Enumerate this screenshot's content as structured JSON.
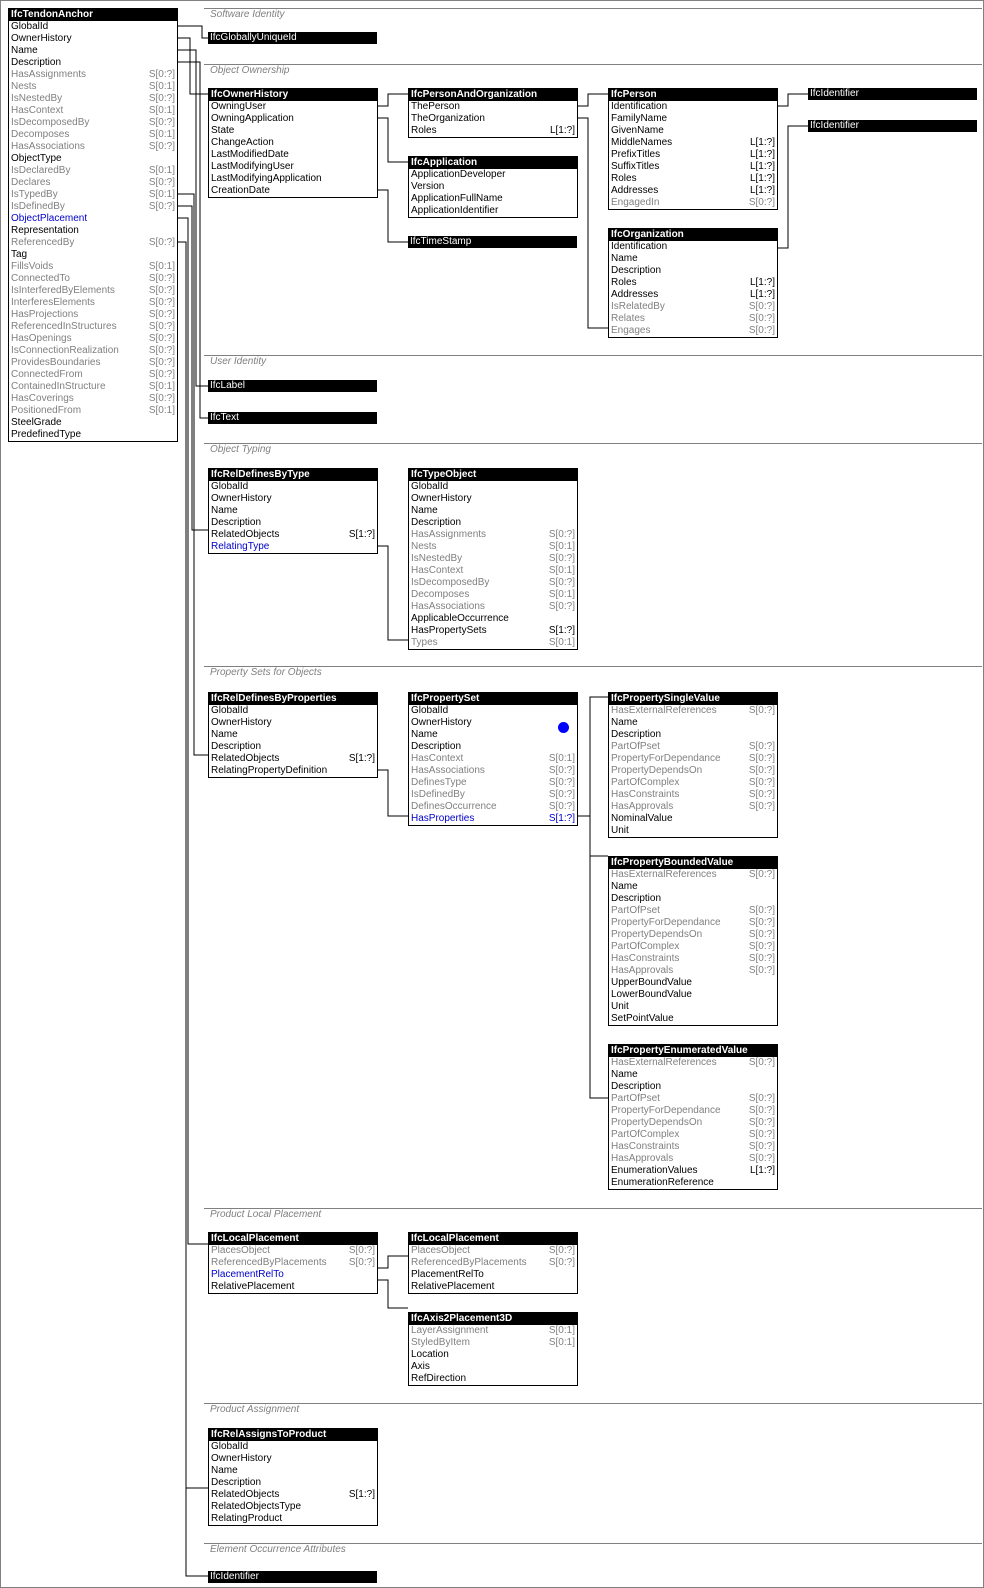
{
  "sections": [
    {
      "title": "Software Identity"
    },
    {
      "title": "Object Ownership"
    },
    {
      "title": "User Identity"
    },
    {
      "title": "Object Typing"
    },
    {
      "title": "Property Sets for Objects"
    },
    {
      "title": "Product Local Placement"
    },
    {
      "title": "Product Assignment"
    },
    {
      "title": "Element Occurrence Attributes"
    }
  ],
  "bars": [
    {
      "label": "IfcGloballyUniqueId"
    },
    {
      "label": "IfcIdentifier"
    },
    {
      "label": "IfcIdentifier"
    },
    {
      "label": "IfcTimeStamp"
    },
    {
      "label": "IfcLabel"
    },
    {
      "label": "IfcText"
    },
    {
      "label": "IfcIdentifier"
    }
  ],
  "entities": [
    {
      "title": "IfcTendonAnchor",
      "rows": [
        {
          "n": "GlobalId",
          "c": "",
          "s": ""
        },
        {
          "n": "OwnerHistory",
          "c": "",
          "s": ""
        },
        {
          "n": "Name",
          "c": "",
          "s": ""
        },
        {
          "n": "Description",
          "c": "",
          "s": ""
        },
        {
          "n": "HasAssignments",
          "c": "S[0:?]",
          "s": "inv"
        },
        {
          "n": "Nests",
          "c": "S[0:1]",
          "s": "inv"
        },
        {
          "n": "IsNestedBy",
          "c": "S[0:?]",
          "s": "inv"
        },
        {
          "n": "HasContext",
          "c": "S[0:1]",
          "s": "inv"
        },
        {
          "n": "IsDecomposedBy",
          "c": "S[0:?]",
          "s": "inv"
        },
        {
          "n": "Decomposes",
          "c": "S[0:1]",
          "s": "inv"
        },
        {
          "n": "HasAssociations",
          "c": "S[0:?]",
          "s": "inv"
        },
        {
          "n": "ObjectType",
          "c": "",
          "s": ""
        },
        {
          "n": "IsDeclaredBy",
          "c": "S[0:1]",
          "s": "inv"
        },
        {
          "n": "Declares",
          "c": "S[0:?]",
          "s": "inv"
        },
        {
          "n": "IsTypedBy",
          "c": "S[0:1]",
          "s": "inv"
        },
        {
          "n": "IsDefinedBy",
          "c": "S[0:?]",
          "s": "inv"
        },
        {
          "n": "ObjectPlacement",
          "c": "",
          "s": "lnk"
        },
        {
          "n": "Representation",
          "c": "",
          "s": ""
        },
        {
          "n": "ReferencedBy",
          "c": "S[0:?]",
          "s": "inv"
        },
        {
          "n": "Tag",
          "c": "",
          "s": ""
        },
        {
          "n": "FillsVoids",
          "c": "S[0:1]",
          "s": "inv"
        },
        {
          "n": "ConnectedTo",
          "c": "S[0:?]",
          "s": "inv"
        },
        {
          "n": "IsInterferedByElements",
          "c": "S[0:?]",
          "s": "inv"
        },
        {
          "n": "InterferesElements",
          "c": "S[0:?]",
          "s": "inv"
        },
        {
          "n": "HasProjections",
          "c": "S[0:?]",
          "s": "inv"
        },
        {
          "n": "ReferencedInStructures",
          "c": "S[0:?]",
          "s": "inv"
        },
        {
          "n": "HasOpenings",
          "c": "S[0:?]",
          "s": "inv"
        },
        {
          "n": "IsConnectionRealization",
          "c": "S[0:?]",
          "s": "inv"
        },
        {
          "n": "ProvidesBoundaries",
          "c": "S[0:?]",
          "s": "inv"
        },
        {
          "n": "ConnectedFrom",
          "c": "S[0:?]",
          "s": "inv"
        },
        {
          "n": "ContainedInStructure",
          "c": "S[0:1]",
          "s": "inv"
        },
        {
          "n": "HasCoverings",
          "c": "S[0:?]",
          "s": "inv"
        },
        {
          "n": "PositionedFrom",
          "c": "S[0:1]",
          "s": "inv"
        },
        {
          "n": "SteelGrade",
          "c": "",
          "s": ""
        },
        {
          "n": "PredefinedType",
          "c": "",
          "s": ""
        }
      ]
    },
    {
      "title": "IfcOwnerHistory",
      "rows": [
        {
          "n": "OwningUser",
          "c": "",
          "s": ""
        },
        {
          "n": "OwningApplication",
          "c": "",
          "s": ""
        },
        {
          "n": "State",
          "c": "",
          "s": ""
        },
        {
          "n": "ChangeAction",
          "c": "",
          "s": ""
        },
        {
          "n": "LastModifiedDate",
          "c": "",
          "s": ""
        },
        {
          "n": "LastModifyingUser",
          "c": "",
          "s": ""
        },
        {
          "n": "LastModifyingApplication",
          "c": "",
          "s": ""
        },
        {
          "n": "CreationDate",
          "c": "",
          "s": ""
        }
      ]
    },
    {
      "title": "IfcPersonAndOrganization",
      "rows": [
        {
          "n": "ThePerson",
          "c": "",
          "s": ""
        },
        {
          "n": "TheOrganization",
          "c": "",
          "s": ""
        },
        {
          "n": "Roles",
          "c": "L[1:?]",
          "s": ""
        }
      ]
    },
    {
      "title": "IfcApplication",
      "rows": [
        {
          "n": "ApplicationDeveloper",
          "c": "",
          "s": ""
        },
        {
          "n": "Version",
          "c": "",
          "s": ""
        },
        {
          "n": "ApplicationFullName",
          "c": "",
          "s": ""
        },
        {
          "n": "ApplicationIdentifier",
          "c": "",
          "s": ""
        }
      ]
    },
    {
      "title": "IfcPerson",
      "rows": [
        {
          "n": "Identification",
          "c": "",
          "s": ""
        },
        {
          "n": "FamilyName",
          "c": "",
          "s": ""
        },
        {
          "n": "GivenName",
          "c": "",
          "s": ""
        },
        {
          "n": "MiddleNames",
          "c": "L[1:?]",
          "s": ""
        },
        {
          "n": "PrefixTitles",
          "c": "L[1:?]",
          "s": ""
        },
        {
          "n": "SuffixTitles",
          "c": "L[1:?]",
          "s": ""
        },
        {
          "n": "Roles",
          "c": "L[1:?]",
          "s": ""
        },
        {
          "n": "Addresses",
          "c": "L[1:?]",
          "s": ""
        },
        {
          "n": "EngagedIn",
          "c": "S[0:?]",
          "s": "inv"
        }
      ]
    },
    {
      "title": "IfcOrganization",
      "rows": [
        {
          "n": "Identification",
          "c": "",
          "s": ""
        },
        {
          "n": "Name",
          "c": "",
          "s": ""
        },
        {
          "n": "Description",
          "c": "",
          "s": ""
        },
        {
          "n": "Roles",
          "c": "L[1:?]",
          "s": ""
        },
        {
          "n": "Addresses",
          "c": "L[1:?]",
          "s": ""
        },
        {
          "n": "IsRelatedBy",
          "c": "S[0:?]",
          "s": "inv"
        },
        {
          "n": "Relates",
          "c": "S[0:?]",
          "s": "inv"
        },
        {
          "n": "Engages",
          "c": "S[0:?]",
          "s": "inv"
        }
      ]
    },
    {
      "title": "IfcRelDefinesByType",
      "rows": [
        {
          "n": "GlobalId",
          "c": "",
          "s": ""
        },
        {
          "n": "OwnerHistory",
          "c": "",
          "s": ""
        },
        {
          "n": "Name",
          "c": "",
          "s": ""
        },
        {
          "n": "Description",
          "c": "",
          "s": ""
        },
        {
          "n": "RelatedObjects",
          "c": "S[1:?]",
          "s": ""
        },
        {
          "n": "RelatingType",
          "c": "",
          "s": "lnk"
        }
      ]
    },
    {
      "title": "IfcTypeObject",
      "rows": [
        {
          "n": "GlobalId",
          "c": "",
          "s": ""
        },
        {
          "n": "OwnerHistory",
          "c": "",
          "s": ""
        },
        {
          "n": "Name",
          "c": "",
          "s": ""
        },
        {
          "n": "Description",
          "c": "",
          "s": ""
        },
        {
          "n": "HasAssignments",
          "c": "S[0:?]",
          "s": "inv"
        },
        {
          "n": "Nests",
          "c": "S[0:1]",
          "s": "inv"
        },
        {
          "n": "IsNestedBy",
          "c": "S[0:?]",
          "s": "inv"
        },
        {
          "n": "HasContext",
          "c": "S[0:1]",
          "s": "inv"
        },
        {
          "n": "IsDecomposedBy",
          "c": "S[0:?]",
          "s": "inv"
        },
        {
          "n": "Decomposes",
          "c": "S[0:1]",
          "s": "inv"
        },
        {
          "n": "HasAssociations",
          "c": "S[0:?]",
          "s": "inv"
        },
        {
          "n": "ApplicableOccurrence",
          "c": "",
          "s": ""
        },
        {
          "n": "HasPropertySets",
          "c": "S[1:?]",
          "s": ""
        },
        {
          "n": "Types",
          "c": "S[0:1]",
          "s": "inv"
        }
      ]
    },
    {
      "title": "IfcRelDefinesByProperties",
      "rows": [
        {
          "n": "GlobalId",
          "c": "",
          "s": ""
        },
        {
          "n": "OwnerHistory",
          "c": "",
          "s": ""
        },
        {
          "n": "Name",
          "c": "",
          "s": ""
        },
        {
          "n": "Description",
          "c": "",
          "s": ""
        },
        {
          "n": "RelatedObjects",
          "c": "S[1:?]",
          "s": ""
        },
        {
          "n": "RelatingPropertyDefinition",
          "c": "",
          "s": ""
        }
      ]
    },
    {
      "title": "IfcPropertySet",
      "rows": [
        {
          "n": "GlobalId",
          "c": "",
          "s": ""
        },
        {
          "n": "OwnerHistory",
          "c": "",
          "s": ""
        },
        {
          "n": "Name",
          "c": "",
          "s": ""
        },
        {
          "n": "Description",
          "c": "",
          "s": ""
        },
        {
          "n": "HasContext",
          "c": "S[0:1]",
          "s": "inv"
        },
        {
          "n": "HasAssociations",
          "c": "S[0:?]",
          "s": "inv"
        },
        {
          "n": "DefinesType",
          "c": "S[0:?]",
          "s": "inv"
        },
        {
          "n": "IsDefinedBy",
          "c": "S[0:?]",
          "s": "inv"
        },
        {
          "n": "DefinesOccurrence",
          "c": "S[0:?]",
          "s": "inv"
        },
        {
          "n": "HasProperties",
          "c": "S[1:?]",
          "s": "lnk"
        }
      ]
    },
    {
      "title": "IfcPropertySingleValue",
      "rows": [
        {
          "n": "HasExternalReferences",
          "c": "S[0:?]",
          "s": "inv"
        },
        {
          "n": "Name",
          "c": "",
          "s": ""
        },
        {
          "n": "Description",
          "c": "",
          "s": ""
        },
        {
          "n": "PartOfPset",
          "c": "S[0:?]",
          "s": "inv"
        },
        {
          "n": "PropertyForDependance",
          "c": "S[0:?]",
          "s": "inv"
        },
        {
          "n": "PropertyDependsOn",
          "c": "S[0:?]",
          "s": "inv"
        },
        {
          "n": "PartOfComplex",
          "c": "S[0:?]",
          "s": "inv"
        },
        {
          "n": "HasConstraints",
          "c": "S[0:?]",
          "s": "inv"
        },
        {
          "n": "HasApprovals",
          "c": "S[0:?]",
          "s": "inv"
        },
        {
          "n": "NominalValue",
          "c": "",
          "s": ""
        },
        {
          "n": "Unit",
          "c": "",
          "s": ""
        }
      ]
    },
    {
      "title": "IfcPropertyBoundedValue",
      "rows": [
        {
          "n": "HasExternalReferences",
          "c": "S[0:?]",
          "s": "inv"
        },
        {
          "n": "Name",
          "c": "",
          "s": ""
        },
        {
          "n": "Description",
          "c": "",
          "s": ""
        },
        {
          "n": "PartOfPset",
          "c": "S[0:?]",
          "s": "inv"
        },
        {
          "n": "PropertyForDependance",
          "c": "S[0:?]",
          "s": "inv"
        },
        {
          "n": "PropertyDependsOn",
          "c": "S[0:?]",
          "s": "inv"
        },
        {
          "n": "PartOfComplex",
          "c": "S[0:?]",
          "s": "inv"
        },
        {
          "n": "HasConstraints",
          "c": "S[0:?]",
          "s": "inv"
        },
        {
          "n": "HasApprovals",
          "c": "S[0:?]",
          "s": "inv"
        },
        {
          "n": "UpperBoundValue",
          "c": "",
          "s": ""
        },
        {
          "n": "LowerBoundValue",
          "c": "",
          "s": ""
        },
        {
          "n": "Unit",
          "c": "",
          "s": ""
        },
        {
          "n": "SetPointValue",
          "c": "",
          "s": ""
        }
      ]
    },
    {
      "title": "IfcPropertyEnumeratedValue",
      "rows": [
        {
          "n": "HasExternalReferences",
          "c": "S[0:?]",
          "s": "inv"
        },
        {
          "n": "Name",
          "c": "",
          "s": ""
        },
        {
          "n": "Description",
          "c": "",
          "s": ""
        },
        {
          "n": "PartOfPset",
          "c": "S[0:?]",
          "s": "inv"
        },
        {
          "n": "PropertyForDependance",
          "c": "S[0:?]",
          "s": "inv"
        },
        {
          "n": "PropertyDependsOn",
          "c": "S[0:?]",
          "s": "inv"
        },
        {
          "n": "PartOfComplex",
          "c": "S[0:?]",
          "s": "inv"
        },
        {
          "n": "HasConstraints",
          "c": "S[0:?]",
          "s": "inv"
        },
        {
          "n": "HasApprovals",
          "c": "S[0:?]",
          "s": "inv"
        },
        {
          "n": "EnumerationValues",
          "c": "L[1:?]",
          "s": ""
        },
        {
          "n": "EnumerationReference",
          "c": "",
          "s": ""
        }
      ]
    },
    {
      "title": "IfcLocalPlacement",
      "rows": [
        {
          "n": "PlacesObject",
          "c": "S[0:?]",
          "s": "inv"
        },
        {
          "n": "ReferencedByPlacements",
          "c": "S[0:?]",
          "s": "inv"
        },
        {
          "n": "PlacementRelTo",
          "c": "",
          "s": "lnk"
        },
        {
          "n": "RelativePlacement",
          "c": "",
          "s": ""
        }
      ]
    },
    {
      "title": "IfcLocalPlacement",
      "rows": [
        {
          "n": "PlacesObject",
          "c": "S[0:?]",
          "s": "inv"
        },
        {
          "n": "ReferencedByPlacements",
          "c": "S[0:?]",
          "s": "inv"
        },
        {
          "n": "PlacementRelTo",
          "c": "",
          "s": ""
        },
        {
          "n": "RelativePlacement",
          "c": "",
          "s": ""
        }
      ]
    },
    {
      "title": "IfcAxis2Placement3D",
      "rows": [
        {
          "n": "LayerAssignment",
          "c": "S[0:1]",
          "s": "inv"
        },
        {
          "n": "StyledByItem",
          "c": "S[0:1]",
          "s": "inv"
        },
        {
          "n": "Location",
          "c": "",
          "s": ""
        },
        {
          "n": "Axis",
          "c": "",
          "s": ""
        },
        {
          "n": "RefDirection",
          "c": "",
          "s": ""
        }
      ]
    },
    {
      "title": "IfcRelAssignsToProduct",
      "rows": [
        {
          "n": "GlobalId",
          "c": "",
          "s": ""
        },
        {
          "n": "OwnerHistory",
          "c": "",
          "s": ""
        },
        {
          "n": "Name",
          "c": "",
          "s": ""
        },
        {
          "n": "Description",
          "c": "",
          "s": ""
        },
        {
          "n": "RelatedObjects",
          "c": "S[1:?]",
          "s": ""
        },
        {
          "n": "RelatedObjectsType",
          "c": "",
          "s": ""
        },
        {
          "n": "RelatingProduct",
          "c": "",
          "s": ""
        }
      ]
    }
  ]
}
